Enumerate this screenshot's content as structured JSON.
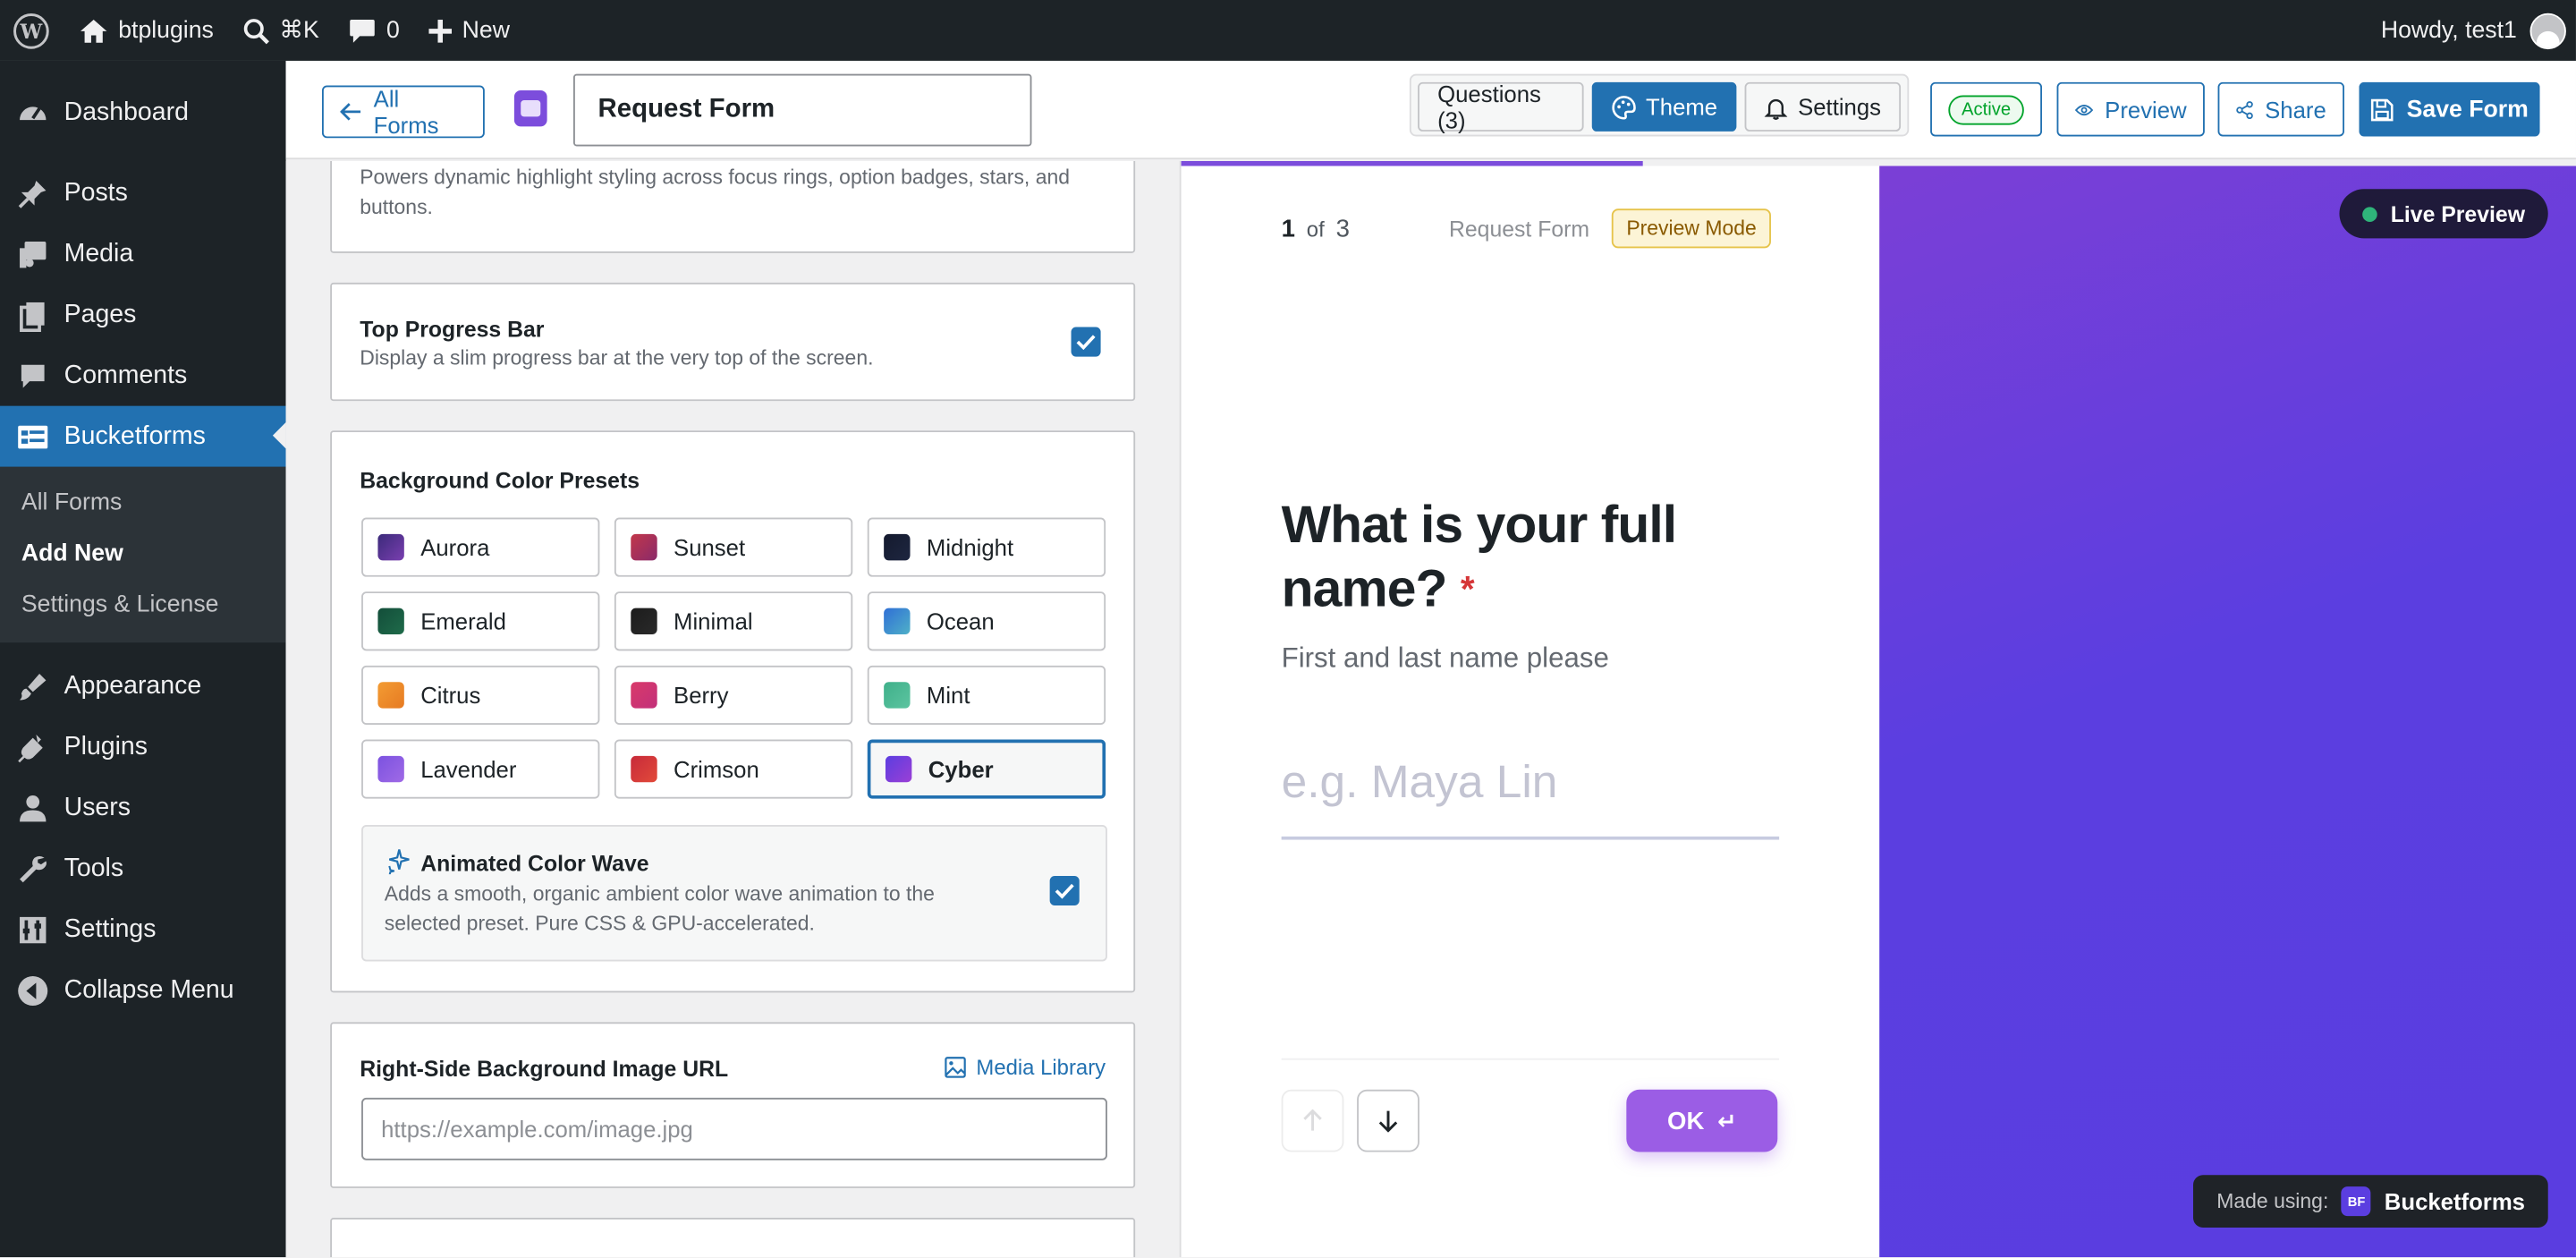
{
  "admin_bar": {
    "site_name": "btplugins",
    "search_shortcut": "⌘K",
    "comments_count": "0",
    "new_label": "New",
    "howdy": "Howdy, test1"
  },
  "sidebar": {
    "items": [
      {
        "label": "Dashboard",
        "icon": "dashboard-icon"
      },
      {
        "label": "Posts",
        "icon": "pin-icon"
      },
      {
        "label": "Media",
        "icon": "media-icon"
      },
      {
        "label": "Pages",
        "icon": "pages-icon"
      },
      {
        "label": "Comments",
        "icon": "comment-icon"
      },
      {
        "label": "Bucketforms",
        "icon": "forms-icon"
      },
      {
        "label": "Appearance",
        "icon": "brush-icon"
      },
      {
        "label": "Plugins",
        "icon": "plugin-icon"
      },
      {
        "label": "Users",
        "icon": "user-icon"
      },
      {
        "label": "Tools",
        "icon": "wrench-icon"
      },
      {
        "label": "Settings",
        "icon": "sliders-icon"
      },
      {
        "label": "Collapse Menu",
        "icon": "collapse-icon"
      }
    ],
    "submenu": [
      "All Forms",
      "Add New",
      "Settings & License"
    ]
  },
  "toolbar": {
    "all_forms": "All Forms",
    "form_title": "Request Form",
    "tab_questions": "Questions (3)",
    "tab_theme": "Theme",
    "tab_settings": "Settings",
    "status": "Active",
    "preview": "Preview",
    "share": "Share",
    "save": "Save Form"
  },
  "editor": {
    "accent_desc": "Powers dynamic highlight styling across focus rings, option badges, stars, and buttons.",
    "progress_title": "Top Progress Bar",
    "progress_desc": "Display a slim progress bar at the very top of the screen.",
    "presets_title": "Background Color Presets",
    "presets": [
      {
        "name": "Aurora",
        "color": "#3b2a7a",
        "color2": "#7a3fb0"
      },
      {
        "name": "Sunset",
        "color": "#c2374a",
        "color2": "#8a2a6a"
      },
      {
        "name": "Midnight",
        "color": "#141a2e",
        "color2": "#1e2640"
      },
      {
        "name": "Emerald",
        "color": "#134e3a",
        "color2": "#1f6b4a"
      },
      {
        "name": "Minimal",
        "color": "#1c1c1c",
        "color2": "#2a2a2a"
      },
      {
        "name": "Ocean",
        "color": "#2f6fd6",
        "color2": "#4fb0c8"
      },
      {
        "name": "Citrus",
        "color": "#f39c33",
        "color2": "#e67a22"
      },
      {
        "name": "Berry",
        "color": "#d93a6a",
        "color2": "#c2307a"
      },
      {
        "name": "Mint",
        "color": "#3fb08a",
        "color2": "#5cc4a0"
      },
      {
        "name": "Lavender",
        "color": "#7b52e0",
        "color2": "#a06ae6"
      },
      {
        "name": "Crimson",
        "color": "#c72a3a",
        "color2": "#e24a3a"
      },
      {
        "name": "Cyber",
        "color": "#5b3ee0",
        "color2": "#9b3fd6"
      }
    ],
    "selected_preset": "Cyber",
    "wave_title": "Animated Color Wave",
    "wave_desc": "Adds a smooth, organic ambient color wave animation to the selected preset. Pure CSS & GPU-accelerated.",
    "bg_image_title": "Right-Side Background Image URL",
    "media_library": "Media Library",
    "bg_image_placeholder": "https://example.com/image.jpg"
  },
  "preview": {
    "step_current": "1",
    "step_of": "of",
    "step_total": "3",
    "form_name": "Request Form",
    "mode_badge": "Preview Mode",
    "question": "What is your full name?",
    "required_mark": "*",
    "hint": "First and last name please",
    "placeholder": "e.g. Maya Lin",
    "ok_label": "OK",
    "ok_key": "↵",
    "live_preview": "Live Preview",
    "made_using": "Made using:",
    "brand": "Bucketforms",
    "brand_logo": "BF",
    "progress_fraction": 0.66
  },
  "colors": {
    "wp_blue": "#2271b1",
    "accent": "#9b5de5",
    "bg_gradient_start": "#7b3fd6",
    "bg_gradient_end": "#5a3de0"
  }
}
